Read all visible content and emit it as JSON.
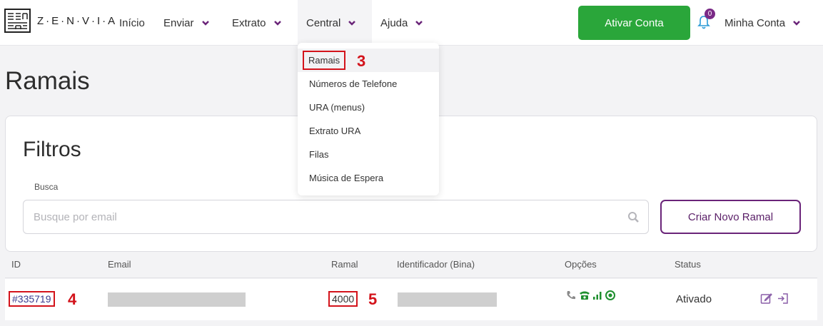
{
  "brand": {
    "name": "Z·E·N·V·I·A"
  },
  "nav": {
    "items": [
      {
        "label": "Início"
      },
      {
        "label": "Enviar"
      },
      {
        "label": "Extrato"
      },
      {
        "label": "Central"
      },
      {
        "label": "Ajuda"
      }
    ],
    "activate_button": "Ativar Conta",
    "notifications_count": "0",
    "account_label": "Minha Conta"
  },
  "dropdown": {
    "items": [
      {
        "label": "Ramais"
      },
      {
        "label": "Números de Telefone"
      },
      {
        "label": "URA (menus)"
      },
      {
        "label": "Extrato URA"
      },
      {
        "label": "Filas"
      },
      {
        "label": "Música de Espera"
      }
    ]
  },
  "page": {
    "title": "Ramais"
  },
  "filters": {
    "title": "Filtros",
    "search_label": "Busca",
    "search_placeholder": "Busque por email",
    "create_button": "Criar Novo Ramal"
  },
  "table": {
    "columns": [
      "ID",
      "Email",
      "Ramal",
      "Identificador (Bina)",
      "Opções",
      "Status"
    ],
    "rows": [
      {
        "id": "#335719",
        "ramal": "4000",
        "status": "Ativado"
      }
    ]
  },
  "annotations": {
    "a3": "3",
    "a4": "4",
    "a5": "5"
  },
  "colors": {
    "accent": "#6a2479",
    "success": "#2aa63a",
    "highlight": "#d3131b"
  }
}
